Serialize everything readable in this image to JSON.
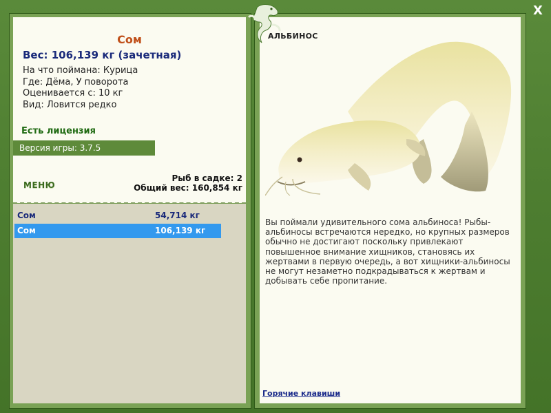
{
  "fish": {
    "name": "Сом",
    "weight_line": "Вес: 106,139 кг (зачетная)",
    "info": [
      "На что поймана: Курица",
      "Где: Дёма, У поворота",
      "Оценивается с: 10 кг",
      "Вид: Ловится редко"
    ],
    "variant_title": "АЛЬБИНОС",
    "description": "Вы поймали удивительного сома альбиноса! Рыбы-альбиносы встречаются нередко, но крупных размеров обычно не достигают поскольку привлекают повышенное внимание хищников, становясь их жертвами в первую очередь, а вот хищники-альбиносы не могут незаметно подкрадываться к жертвам и добывать себе пропитание."
  },
  "license_text": "Есть лицензия",
  "version_text": "Версия игры: 3.7.5",
  "menu_label": "МЕНЮ",
  "keepnet": {
    "count_line": "Рыб в садке: 2",
    "total_line": "Общий вес: 160,854 кг"
  },
  "catch_list": [
    {
      "name": "Сом",
      "weight": "54,714 кг",
      "selected": false
    },
    {
      "name": "Сом",
      "weight": "106,139 кг",
      "selected": true
    }
  ],
  "hotkeys_label": "Горячие клавиши",
  "close_label": "X",
  "icons": {
    "close": "close-icon",
    "emblem": "lizard-emblem-icon"
  },
  "colors": {
    "frame_green": "#4d7d30",
    "panel_cream": "#fbfbf1",
    "list_bg": "#d9d6c2",
    "selected_row": "#3399ee",
    "fish_name": "#c0501a",
    "weight_text": "#1a2a7a",
    "license_text": "#1f6a12"
  }
}
